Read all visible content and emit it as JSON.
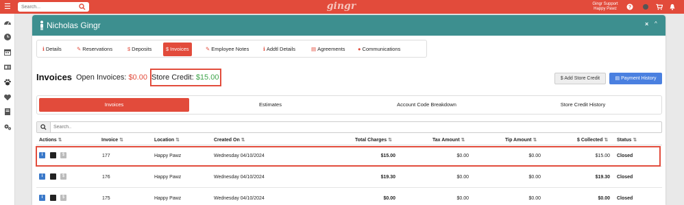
{
  "topbar": {
    "search_placeholder": "Search...",
    "logo": "gingr",
    "user_line1": "Gingr Support",
    "user_line2": "Happy Pawz",
    "icons": [
      "menu-icon",
      "search-icon",
      "help-icon",
      "status-icon",
      "cart-icon",
      "bell-icon"
    ]
  },
  "sidebar": {
    "icons": [
      "dashboard-icon",
      "clock-icon",
      "calendar-icon",
      "id-card-icon",
      "paw-icon",
      "heart-icon",
      "book-icon",
      "gears-icon"
    ]
  },
  "panel": {
    "title": "Nicholas Gingr",
    "close": "×",
    "collapse": "^"
  },
  "tabs": [
    {
      "icon": "ℹ",
      "label": "Details"
    },
    {
      "icon": "✎",
      "label": "Reservations"
    },
    {
      "icon": "$",
      "label": "Deposits"
    },
    {
      "icon": "$",
      "label": "Invoices"
    },
    {
      "icon": "✎",
      "label": "Employee Notes"
    },
    {
      "icon": "ℹ",
      "label": "Addtl Details"
    },
    {
      "icon": "▤",
      "label": "Agreements"
    },
    {
      "icon": "●",
      "label": "Communications"
    }
  ],
  "invoices": {
    "title": "Invoices",
    "open_label": "Open Invoices:",
    "open_value": "$0.00",
    "credit_label": "Store Credit:",
    "credit_value": "$15.00"
  },
  "buttons": {
    "add_credit": "$ Add Store Credit",
    "payment_history": "Payment History"
  },
  "subtabs": [
    "Invoices",
    "Estimates",
    "Account Code Breakdown",
    "Store Credit History"
  ],
  "table": {
    "search_placeholder": "Search..",
    "columns": [
      "Actions",
      "Invoice",
      "Location",
      "Created On",
      "Total Charges",
      "Tax Amount",
      "Tip Amount",
      "$ Collected",
      "Status"
    ],
    "rows": [
      {
        "invoice": "177",
        "location": "Happy Pawz",
        "created": "Wednesday 04/10/2024",
        "total": "$15.00",
        "tax": "$0.00",
        "tip": "$0.00",
        "collected": "$15.00",
        "status": "Closed"
      },
      {
        "invoice": "176",
        "location": "Happy Pawz",
        "created": "Wednesday 04/10/2024",
        "total": "$19.30",
        "tax": "$0.00",
        "tip": "$0.00",
        "collected": "$19.30",
        "status": "Closed"
      },
      {
        "invoice": "175",
        "location": "Happy Pawz",
        "created": "Wednesday 04/10/2024",
        "total": "$0.00",
        "tax": "$0.00",
        "tip": "$0.00",
        "collected": "$0.00",
        "status": "Closed"
      }
    ]
  },
  "colors": {
    "brand_red": "#e24b3b",
    "teal_header": "#3d8f8f",
    "credit_green": "#3ea44a",
    "primary_blue": "#4a80e0"
  }
}
